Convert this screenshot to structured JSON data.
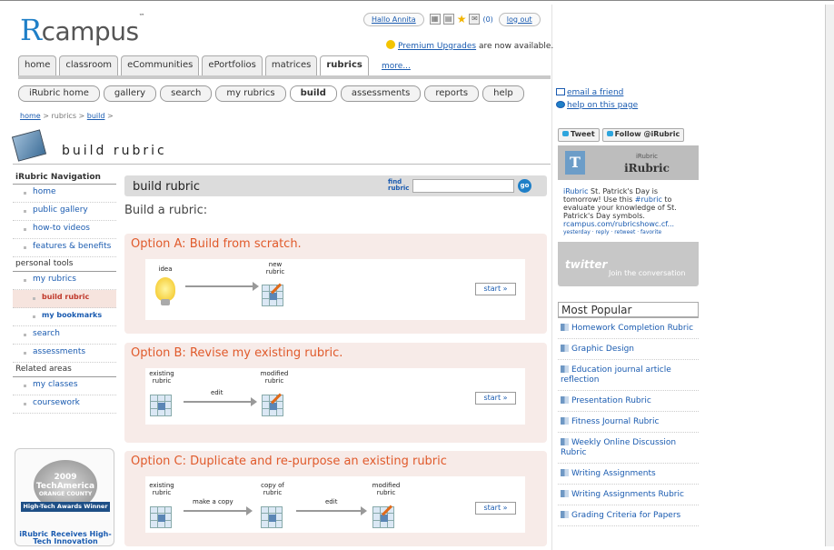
{
  "logo": {
    "r": "R",
    "rest": "campus",
    "tm": "™"
  },
  "userbar": {
    "hello": "Hallo Annita",
    "count": "(0)",
    "logout": "log out"
  },
  "premium": {
    "link": "Premium Upgrades",
    "text": " are now available."
  },
  "main_tabs": [
    "home",
    "classroom",
    "eCommunities",
    "ePortfolios",
    "matrices",
    "rubrics"
  ],
  "more": "more...",
  "sub_tabs": [
    "iRubric home",
    "gallery",
    "search",
    "my rubrics",
    "build",
    "assessments",
    "reports",
    "help"
  ],
  "breadcrumb": {
    "home": "home",
    "sep1": " > rubrics > ",
    "build": "build",
    "sep2": " >"
  },
  "page_title": "build rubric",
  "nav": {
    "header": "iRubric Navigation",
    "items": [
      "home",
      "public gallery",
      "how-to videos",
      "features & benefits"
    ],
    "personal": "personal tools",
    "my_rubrics": "my rubrics",
    "build_rubric": "build rubric",
    "bookmarks": "my bookmarks",
    "search": "search",
    "assessments": "assessments",
    "related": "Related areas",
    "my_classes": "my classes",
    "coursework": "coursework"
  },
  "award": {
    "year": "2009",
    "brand": "TechAmerica",
    "region": "ORANGE COUNTY",
    "ribbon": "High-Tech Awards Winner",
    "caption": "iRubric Receives High-Tech Innovation"
  },
  "content": {
    "title": "build rubric",
    "find": "find rubric",
    "go": "go",
    "subtitle": "Build a rubric:"
  },
  "options": {
    "a": {
      "title": "Option A: Build from scratch.",
      "idea": "idea",
      "new": "new rubric",
      "start": "start »"
    },
    "b": {
      "title": "Option B: Revise my existing rubric.",
      "existing": "existing rubric",
      "edit": "edit",
      "modified": "modified rubric",
      "start": "start »"
    },
    "c": {
      "title": "Option C: Duplicate and re-purpose an existing rubric",
      "existing": "existing rubric",
      "copy": "make a copy",
      "copyof": "copy of rubric",
      "edit": "edit",
      "modified": "modified rubric",
      "start": "start »"
    }
  },
  "right": {
    "email": "email a friend",
    "help": "help on this page",
    "tweet": "Tweet",
    "follow": "Follow @iRubric"
  },
  "twitter": {
    "small": "iRubric",
    "name": "iRubric",
    "handle": "iRubric",
    "text": " St. Patrick's Day is tomorrow! Use this ",
    "hashtag": "#rubric",
    "text2": " to evaluate your knowledge of St. Patrick's Day symbols. ",
    "link": "rcampus.com/rubricshowc.cf...",
    "meta": "yesterday · reply · retweet · favorite",
    "brand": "twitter",
    "join": "Join the conversation"
  },
  "popular": {
    "title": "Most Popular",
    "items": [
      "Homework Completion Rubric",
      "Graphic Design",
      "Education journal article reflection",
      "Presentation Rubric",
      "Fitness Journal Rubric",
      "Weekly Online Discussion Rubric",
      "Writing Assignments",
      "Writing Assignments Rubric",
      "Grading Criteria for Papers"
    ]
  }
}
